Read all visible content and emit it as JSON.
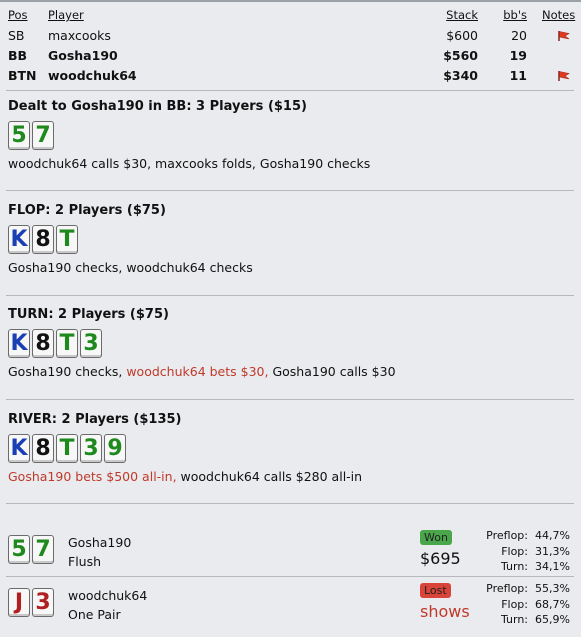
{
  "players": {
    "headers": {
      "pos": "Pos",
      "player": "Player",
      "stack": "Stack",
      "bbs": "bb's",
      "notes": "Notes"
    },
    "rows": [
      {
        "pos": "SB",
        "name": "maxcooks",
        "stack": "$600",
        "bbs": "20",
        "note": true
      },
      {
        "pos": "BB",
        "name": "Gosha190",
        "stack": "$560",
        "bbs": "19",
        "note": false
      },
      {
        "pos": "BTN",
        "name": "woodchuk64",
        "stack": "$340",
        "bbs": "11",
        "note": true
      }
    ]
  },
  "preflop": {
    "title": "Dealt to Gosha190 in BB: 3 Players ($15)",
    "cards": [
      {
        "rank": "5",
        "suit": "clubs",
        "color": "#1e8a1e"
      },
      {
        "rank": "7",
        "suit": "clubs",
        "color": "#1e8a1e"
      }
    ],
    "action": "woodchuk64 calls $30, maxcooks folds, Gosha190 checks"
  },
  "flop": {
    "title": "FLOP: 2 Players ($75)",
    "cards": [
      {
        "rank": "K",
        "suit": "diamonds"
      },
      {
        "rank": "8",
        "suit": "spades"
      },
      {
        "rank": "T",
        "suit": "clubs"
      }
    ],
    "action": "Gosha190 checks, woodchuk64 checks"
  },
  "turn": {
    "title": "TURN: 2 Players ($75)",
    "cards": [
      {
        "rank": "K",
        "suit": "diamonds"
      },
      {
        "rank": "8",
        "suit": "spades"
      },
      {
        "rank": "T",
        "suit": "clubs"
      },
      {
        "rank": "3",
        "suit": "clubs"
      }
    ],
    "action_a": "Gosha190 checks, ",
    "action_b": "woodchuk64 bets $30,",
    "action_c": " Gosha190 calls $30"
  },
  "river": {
    "title": "RIVER: 2 Players ($135)",
    "cards": [
      {
        "rank": "K",
        "suit": "diamonds"
      },
      {
        "rank": "8",
        "suit": "spades"
      },
      {
        "rank": "T",
        "suit": "clubs"
      },
      {
        "rank": "3",
        "suit": "clubs"
      },
      {
        "rank": "9",
        "suit": "clubs"
      }
    ],
    "action_a": "Gosha190 bets $500 all-in,",
    "action_b": " woodchuk64 calls $280 all-in"
  },
  "results": [
    {
      "cards": [
        {
          "rank": "5",
          "suit": "clubs"
        },
        {
          "rank": "7",
          "suit": "clubs"
        }
      ],
      "name": "Gosha190",
      "hand": "Flush",
      "badge": "Won",
      "amount": "$695",
      "eq_labels": [
        "Preflop:",
        "Flop:",
        "Turn:"
      ],
      "eq_values": [
        "44,7%",
        "31,3%",
        "34,1%"
      ]
    },
    {
      "cards": [
        {
          "rank": "J",
          "suit": "hearts"
        },
        {
          "rank": "3",
          "suit": "hearts"
        }
      ],
      "name": "woodchuk64",
      "hand": "One Pair",
      "badge": "Lost",
      "amount": "shows",
      "eq_labels": [
        "Preflop:",
        "Flop:",
        "Turn:"
      ],
      "eq_values": [
        "55,3%",
        "68,7%",
        "65,9%"
      ]
    }
  ],
  "colors": {
    "clubs": "#1e8a1e",
    "diamonds": "#1a3fb5",
    "spades": "#111111",
    "hearts": "#b02020",
    "accent_red": "#c0392b",
    "won": "#4aa64a",
    "lost": "#d9443a"
  },
  "icons": {
    "note": "red-flag-icon"
  }
}
